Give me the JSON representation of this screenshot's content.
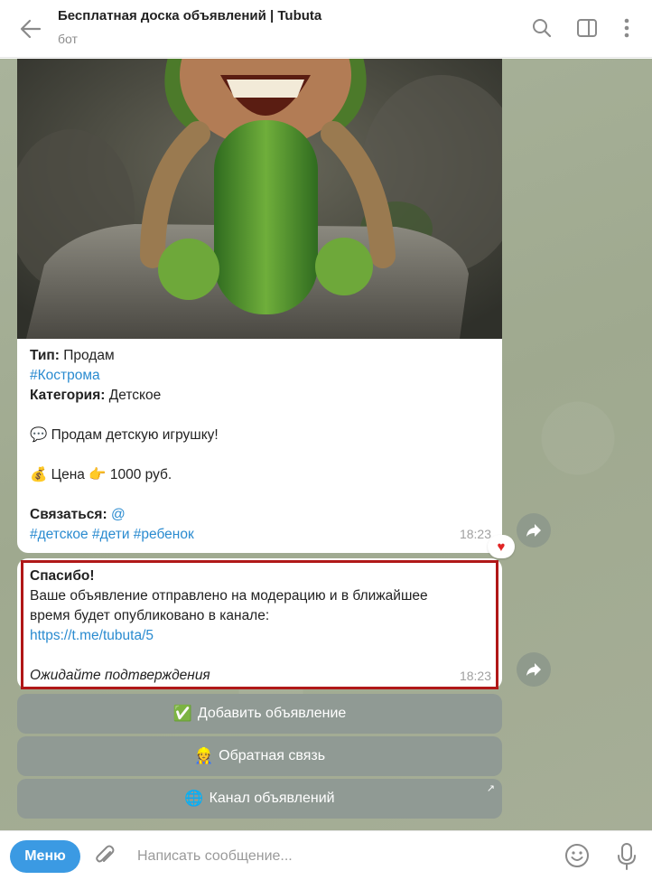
{
  "header": {
    "title": "Бесплатная доска объявлений | Tubuta",
    "subtitle": "бот"
  },
  "message1": {
    "type_label": "Тип:",
    "type_value": " Продам",
    "city_tag": "#Кострома",
    "category_label": "Категория:",
    "category_value": " Детское",
    "description": "Продам детскую игрушку!",
    "description_emoji": "💬",
    "price_emoji": "💰",
    "price_prefix": "Цена",
    "pointer_emoji": "👉",
    "price_value": "1000 руб.",
    "contact_label": "Связаться:",
    "contact_value": "@",
    "tags": "#детское #дети #ребенок",
    "time": "18:23",
    "reaction": "♥"
  },
  "message2": {
    "title": "Спасибо!",
    "line1": "Ваше объявление отправлено на модерацию и в ближайшее",
    "line2": "время будет опубликовано в канале:",
    "link": "https://t.me/tubuta/5",
    "footer": "Ожидайте подтверждения",
    "time": "18:23"
  },
  "keyboard": {
    "buttons": [
      {
        "emoji": "✅",
        "label": "Добавить объявление"
      },
      {
        "emoji": "👷",
        "label": "Обратная связь"
      },
      {
        "emoji": "🌐",
        "label": "Канал объявлений",
        "corner": "↗"
      }
    ]
  },
  "input": {
    "menu_label": "Меню",
    "placeholder": "Написать сообщение..."
  },
  "colors": {
    "accent": "#3b9ae3",
    "link": "#2a8bd0",
    "highlight_border": "#b01818",
    "keyboard_button": "#909a94"
  }
}
